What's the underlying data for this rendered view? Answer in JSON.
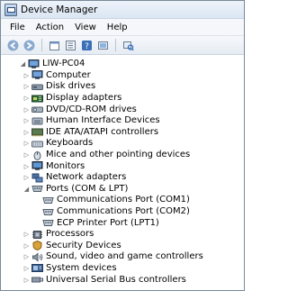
{
  "window": {
    "title": "Device Manager"
  },
  "menu": {
    "items": [
      "File",
      "Action",
      "View",
      "Help"
    ]
  },
  "toolbar": {
    "buttons": [
      "back-icon",
      "forward-icon",
      "properties-icon",
      "tree-icon",
      "help-icon",
      "update-driver-icon",
      "scan-hardware-icon"
    ]
  },
  "tree": {
    "root": "LIW-PC04",
    "categories": [
      {
        "label": "Computer",
        "icon": "computer-icon",
        "expanded": false
      },
      {
        "label": "Disk drives",
        "icon": "disk-drive-icon",
        "expanded": false
      },
      {
        "label": "Display adapters",
        "icon": "display-adapter-icon",
        "expanded": false
      },
      {
        "label": "DVD/CD-ROM drives",
        "icon": "dvd-drive-icon",
        "expanded": false
      },
      {
        "label": "Human Interface Devices",
        "icon": "hid-icon",
        "expanded": false
      },
      {
        "label": "IDE ATA/ATAPI controllers",
        "icon": "ide-controller-icon",
        "expanded": false
      },
      {
        "label": "Keyboards",
        "icon": "keyboard-icon",
        "expanded": false
      },
      {
        "label": "Mice and other pointing devices",
        "icon": "mouse-icon",
        "expanded": false
      },
      {
        "label": "Monitors",
        "icon": "monitor-icon",
        "expanded": false
      },
      {
        "label": "Network adapters",
        "icon": "network-adapter-icon",
        "expanded": false
      },
      {
        "label": "Ports (COM & LPT)",
        "icon": "port-icon",
        "expanded": true,
        "children": [
          "Communications Port (COM1)",
          "Communications Port (COM2)",
          "ECP Printer Port (LPT1)"
        ]
      },
      {
        "label": "Processors",
        "icon": "processor-icon",
        "expanded": false
      },
      {
        "label": "Security Devices",
        "icon": "security-icon",
        "expanded": false
      },
      {
        "label": "Sound, video and game controllers",
        "icon": "sound-icon",
        "expanded": false
      },
      {
        "label": "System devices",
        "icon": "system-device-icon",
        "expanded": false
      },
      {
        "label": "Universal Serial Bus controllers",
        "icon": "usb-icon",
        "expanded": false
      }
    ]
  },
  "colors": {
    "accent": "#2b6cc4",
    "expander": "#6f6f6f"
  }
}
